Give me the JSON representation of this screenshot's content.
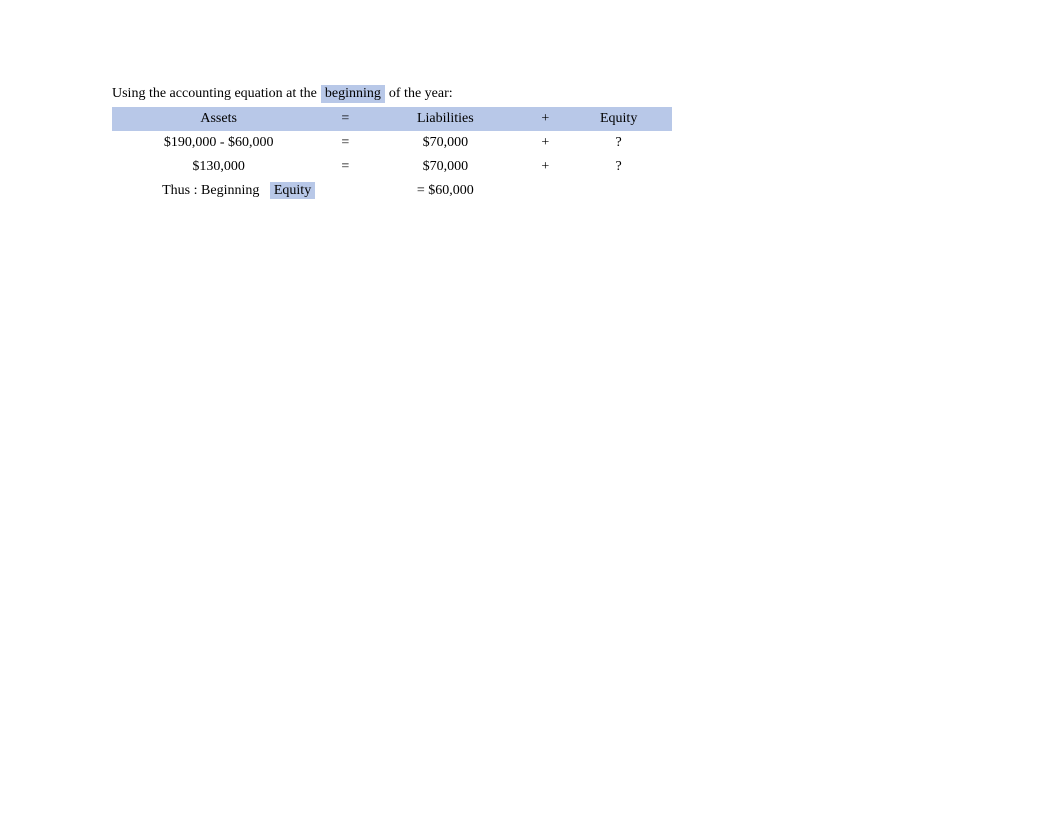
{
  "intro": {
    "text1": "Using the accounting equation at the",
    "text2": "beginning",
    "text3": "of the year:"
  },
  "table": {
    "header": {
      "assets": "Assets",
      "equals": "=",
      "liabilities": "Liabilities",
      "plus": "+",
      "equity": "Equity"
    },
    "row1": {
      "assets": "$190,000 - $60,000",
      "equals": "=",
      "liabilities": "$70,000",
      "plus": "+",
      "equity": "?"
    },
    "row2": {
      "assets": "$130,000",
      "equals": "=",
      "liabilities": "$70,000",
      "plus": "+",
      "equity": "?"
    },
    "conclusion": {
      "label": "Thus : Beginning",
      "equity_label": "Equity",
      "result": "= $60,000"
    }
  }
}
